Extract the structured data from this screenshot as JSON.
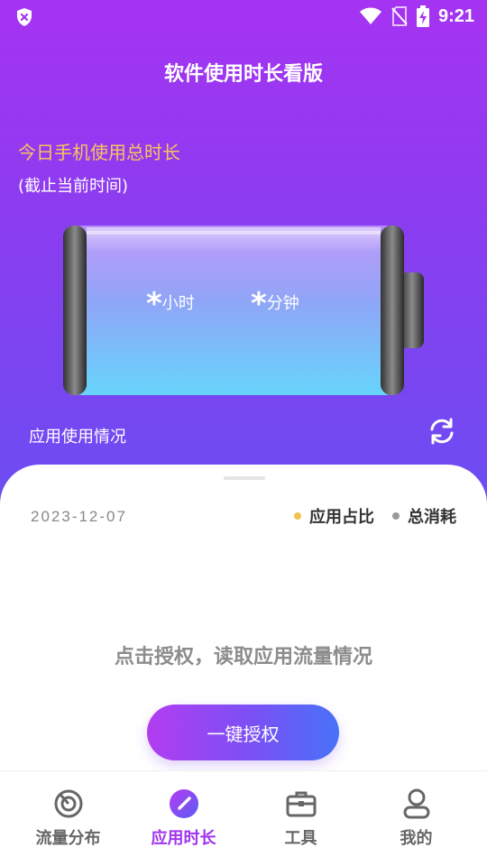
{
  "status_bar": {
    "time": "9:21"
  },
  "header": {
    "title": "软件使用时长看版"
  },
  "today": {
    "title": "今日手机使用总时长",
    "subtitle": "(截止当前时间)",
    "hours_value": "*",
    "hours_unit": "小时",
    "minutes_value": "*",
    "minutes_unit": "分钟"
  },
  "usage_section": {
    "label": "应用使用情况"
  },
  "sheet": {
    "date": "2023-12-07",
    "legend": [
      {
        "label": "应用占比",
        "color": "#f2c14e"
      },
      {
        "label": "总消耗",
        "color": "#9a9a9a"
      }
    ],
    "auth_hint": "点击授权，读取应用流量情况",
    "auth_button": "一键授权"
  },
  "tabs": [
    {
      "label": "流量分布",
      "icon": "traffic-dial-icon",
      "active": false
    },
    {
      "label": "应用时长",
      "icon": "compass-gauge-icon",
      "active": true
    },
    {
      "label": "工具",
      "icon": "toolbox-icon",
      "active": false
    },
    {
      "label": "我的",
      "icon": "profile-icon",
      "active": false
    }
  ],
  "colors": {
    "hero_top": "#a533f2",
    "hero_bottom": "#6c4df2",
    "today_title": "#f8c45c",
    "accent": "#a033f0"
  }
}
